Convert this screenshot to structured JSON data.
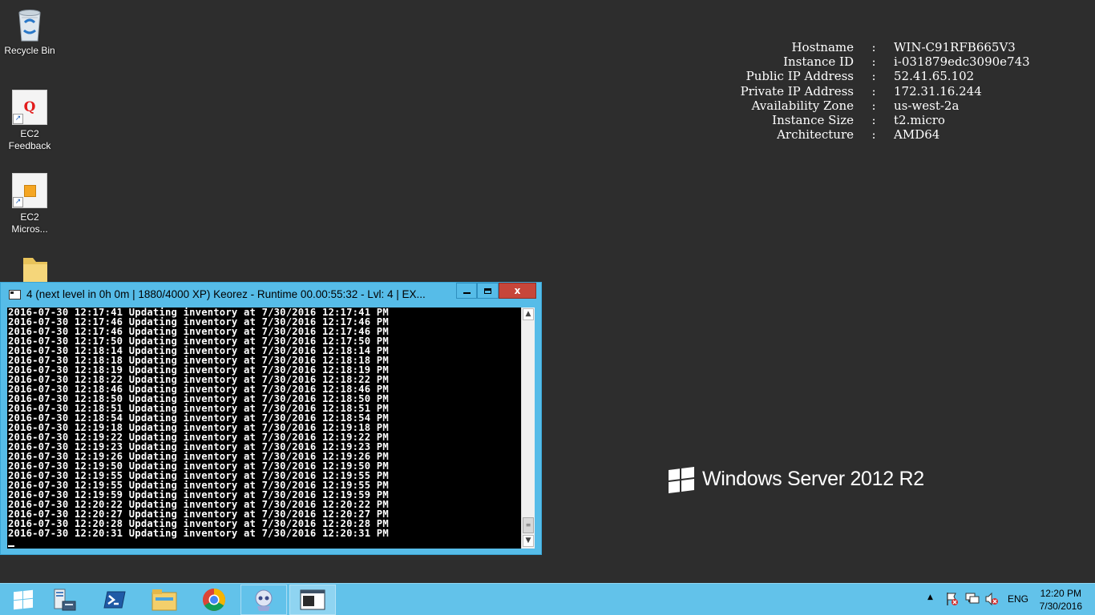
{
  "desktop": {
    "icons": [
      {
        "label": "Recycle Bin",
        "icon": "recycle-bin-icon"
      },
      {
        "label": "EC2\nFeedback",
        "label1": "EC2",
        "label2": "Feedback",
        "icon": "ec2-feedback-icon"
      },
      {
        "label1": "EC2",
        "label2": "Micros...",
        "icon": "ec2-microsoft-icon"
      },
      {
        "icon": "folder-icon"
      }
    ]
  },
  "bginfo": {
    "rows": [
      {
        "key": "Hostname",
        "value": "WIN-C91RFB665V3"
      },
      {
        "key": "Instance ID",
        "value": "i-031879edc3090e743"
      },
      {
        "key": "Public IP Address",
        "value": "52.41.65.102"
      },
      {
        "key": "Private IP Address",
        "value": "172.31.16.244"
      },
      {
        "key": "Availability Zone",
        "value": "us-west-2a"
      },
      {
        "key": "Instance Size",
        "value": "t2.micro"
      },
      {
        "key": "Architecture",
        "value": "AMD64"
      }
    ],
    "separator": ":"
  },
  "branding": {
    "text": "Windows Server 2012 R2"
  },
  "console": {
    "title": "4 (next level in 0h 0m | 1880/4000 XP) Keorez - Runtime 00.00:55:32 - Lvl: 4 | EX...",
    "close_label": "x",
    "lines": [
      "2016-07-30 12:17:41 Updating inventory at 7/30/2016 12:17:41 PM",
      "2016-07-30 12:17:46 Updating inventory at 7/30/2016 12:17:46 PM",
      "2016-07-30 12:17:46 Updating inventory at 7/30/2016 12:17:46 PM",
      "2016-07-30 12:17:50 Updating inventory at 7/30/2016 12:17:50 PM",
      "2016-07-30 12:18:14 Updating inventory at 7/30/2016 12:18:14 PM",
      "2016-07-30 12:18:18 Updating inventory at 7/30/2016 12:18:18 PM",
      "2016-07-30 12:18:19 Updating inventory at 7/30/2016 12:18:19 PM",
      "2016-07-30 12:18:22 Updating inventory at 7/30/2016 12:18:22 PM",
      "2016-07-30 12:18:46 Updating inventory at 7/30/2016 12:18:46 PM",
      "2016-07-30 12:18:50 Updating inventory at 7/30/2016 12:18:50 PM",
      "2016-07-30 12:18:51 Updating inventory at 7/30/2016 12:18:51 PM",
      "2016-07-30 12:18:54 Updating inventory at 7/30/2016 12:18:54 PM",
      "2016-07-30 12:19:18 Updating inventory at 7/30/2016 12:19:18 PM",
      "2016-07-30 12:19:22 Updating inventory at 7/30/2016 12:19:22 PM",
      "2016-07-30 12:19:23 Updating inventory at 7/30/2016 12:19:23 PM",
      "2016-07-30 12:19:26 Updating inventory at 7/30/2016 12:19:26 PM",
      "2016-07-30 12:19:50 Updating inventory at 7/30/2016 12:19:50 PM",
      "2016-07-30 12:19:55 Updating inventory at 7/30/2016 12:19:55 PM",
      "2016-07-30 12:19:55 Updating inventory at 7/30/2016 12:19:55 PM",
      "2016-07-30 12:19:59 Updating inventory at 7/30/2016 12:19:59 PM",
      "2016-07-30 12:20:22 Updating inventory at 7/30/2016 12:20:22 PM",
      "2016-07-30 12:20:27 Updating inventory at 7/30/2016 12:20:27 PM",
      "2016-07-30 12:20:28 Updating inventory at 7/30/2016 12:20:28 PM",
      "2016-07-30 12:20:31 Updating inventory at 7/30/2016 12:20:31 PM"
    ]
  },
  "taskbar": {
    "items": [
      "start-icon",
      "server-manager-icon",
      "powershell-icon",
      "file-explorer-icon",
      "chrome-icon",
      "bot-app-icon",
      "console-app-icon"
    ],
    "tray": {
      "language": "ENG",
      "time": "12:20 PM",
      "date": "7/30/2016"
    }
  },
  "colors": {
    "desktop": "#2d2d2d",
    "taskbar": "#62c2ea",
    "window_frame": "#56bce8",
    "close": "#c7463a"
  }
}
